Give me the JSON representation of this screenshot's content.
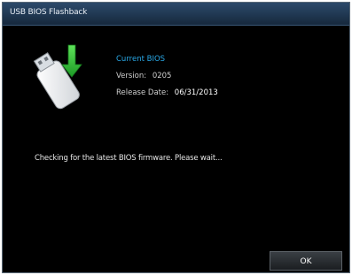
{
  "window": {
    "title": "USB BIOS Flashback"
  },
  "bios_info": {
    "heading": "Current BIOS",
    "version_label": "Version:",
    "version_value": "0205",
    "release_label": "Release Date:",
    "release_value": "06/31/2013"
  },
  "status": {
    "message": "Checking for the latest BIOS firmware. Please wait..."
  },
  "buttons": {
    "ok_label": "OK"
  },
  "icons": {
    "usb": "usb-drive-download-icon"
  },
  "colors": {
    "accent": "#29a9e8",
    "arrow": "#2fc03a",
    "background": "#000000"
  }
}
